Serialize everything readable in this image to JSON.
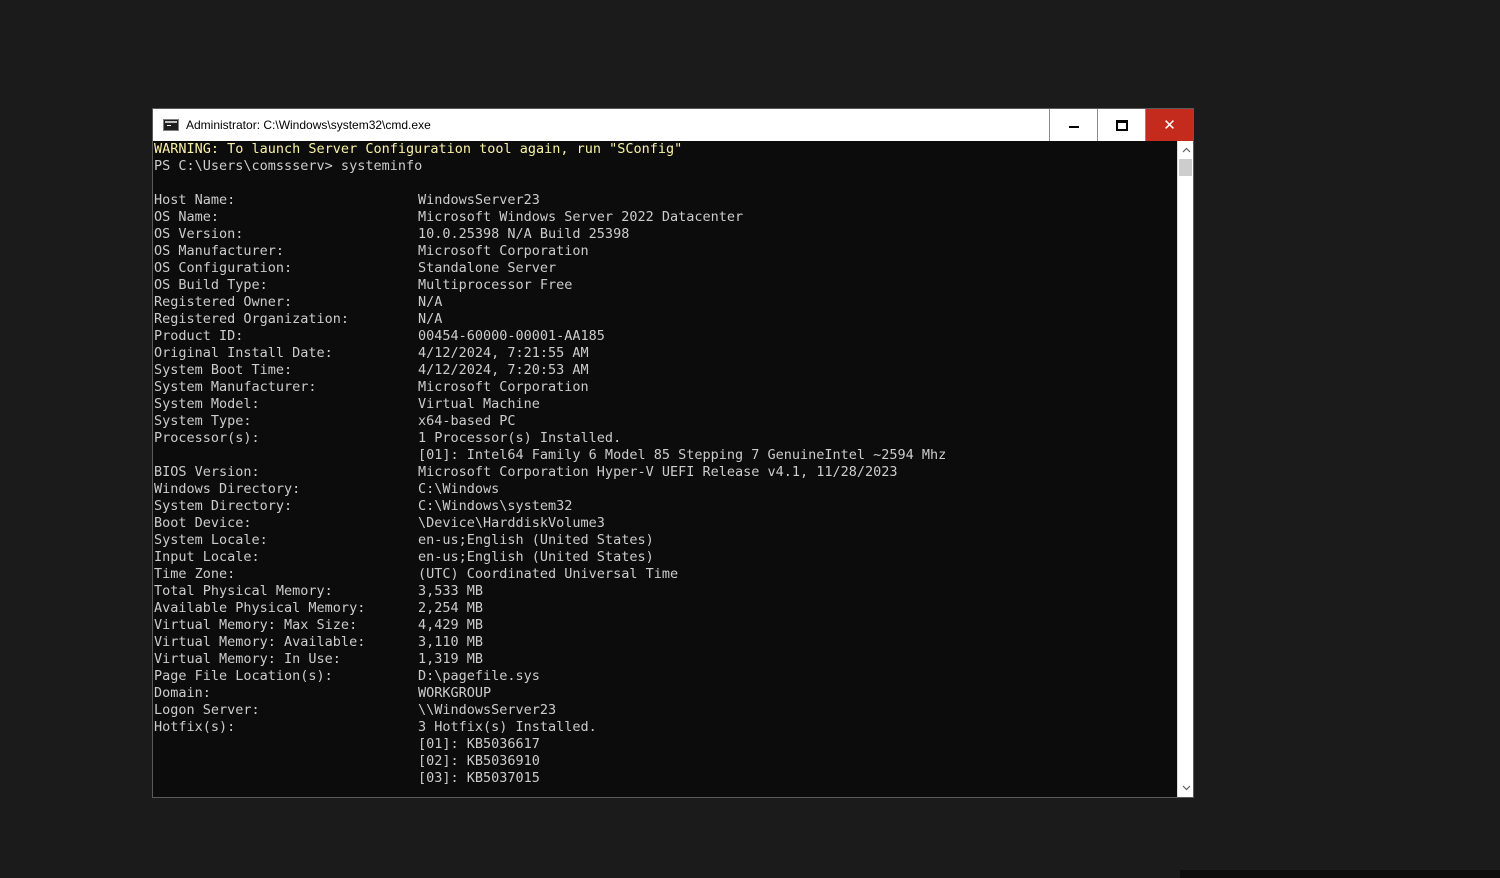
{
  "window": {
    "title": "Administrator: C:\\Windows\\system32\\cmd.exe",
    "buttons": {
      "minimize_icon": "minimize-icon",
      "maximize_icon": "maximize-icon",
      "close_glyph": "✕"
    }
  },
  "colors": {
    "console_bg": "#0c0c0c",
    "console_text": "#cccccc",
    "warning_text": "#f9f1a5",
    "close_button": "#c42b1c"
  },
  "console": {
    "warning": "WARNING: To launch Server Configuration tool again, run \"SConfig\"",
    "prompt": "PS C:\\Users\\comssserv> systeminfo",
    "rows": [
      {
        "label": "Host Name:",
        "value": "WindowsServer23"
      },
      {
        "label": "OS Name:",
        "value": "Microsoft Windows Server 2022 Datacenter"
      },
      {
        "label": "OS Version:",
        "value": "10.0.25398 N/A Build 25398"
      },
      {
        "label": "OS Manufacturer:",
        "value": "Microsoft Corporation"
      },
      {
        "label": "OS Configuration:",
        "value": "Standalone Server"
      },
      {
        "label": "OS Build Type:",
        "value": "Multiprocessor Free"
      },
      {
        "label": "Registered Owner:",
        "value": "N/A"
      },
      {
        "label": "Registered Organization:",
        "value": "N/A"
      },
      {
        "label": "Product ID:",
        "value": "00454-60000-00001-AA185"
      },
      {
        "label": "Original Install Date:",
        "value": "4/12/2024, 7:21:55 AM"
      },
      {
        "label": "System Boot Time:",
        "value": "4/12/2024, 7:20:53 AM"
      },
      {
        "label": "System Manufacturer:",
        "value": "Microsoft Corporation"
      },
      {
        "label": "System Model:",
        "value": "Virtual Machine"
      },
      {
        "label": "System Type:",
        "value": "x64-based PC"
      },
      {
        "label": "Processor(s):",
        "value": "1 Processor(s) Installed."
      },
      {
        "label": "",
        "value": "[01]: Intel64 Family 6 Model 85 Stepping 7 GenuineIntel ~2594 Mhz"
      },
      {
        "label": "BIOS Version:",
        "value": "Microsoft Corporation Hyper-V UEFI Release v4.1, 11/28/2023"
      },
      {
        "label": "Windows Directory:",
        "value": "C:\\Windows"
      },
      {
        "label": "System Directory:",
        "value": "C:\\Windows\\system32"
      },
      {
        "label": "Boot Device:",
        "value": "\\Device\\HarddiskVolume3"
      },
      {
        "label": "System Locale:",
        "value": "en-us;English (United States)"
      },
      {
        "label": "Input Locale:",
        "value": "en-us;English (United States)"
      },
      {
        "label": "Time Zone:",
        "value": "(UTC) Coordinated Universal Time"
      },
      {
        "label": "Total Physical Memory:",
        "value": "3,533 MB"
      },
      {
        "label": "Available Physical Memory:",
        "value": "2,254 MB"
      },
      {
        "label": "Virtual Memory: Max Size:",
        "value": "4,429 MB"
      },
      {
        "label": "Virtual Memory: Available:",
        "value": "3,110 MB"
      },
      {
        "label": "Virtual Memory: In Use:",
        "value": "1,319 MB"
      },
      {
        "label": "Page File Location(s):",
        "value": "D:\\pagefile.sys"
      },
      {
        "label": "Domain:",
        "value": "WORKGROUP"
      },
      {
        "label": "Logon Server:",
        "value": "\\\\WindowsServer23"
      },
      {
        "label": "Hotfix(s):",
        "value": "3 Hotfix(s) Installed."
      },
      {
        "label": "",
        "value": "[01]: KB5036617"
      },
      {
        "label": "",
        "value": "[02]: KB5036910"
      },
      {
        "label": "",
        "value": "[03]: KB5037015"
      }
    ]
  },
  "scrollbar": {
    "up_icon": "scroll-up-arrow-icon",
    "down_icon": "scroll-down-arrow-icon"
  }
}
